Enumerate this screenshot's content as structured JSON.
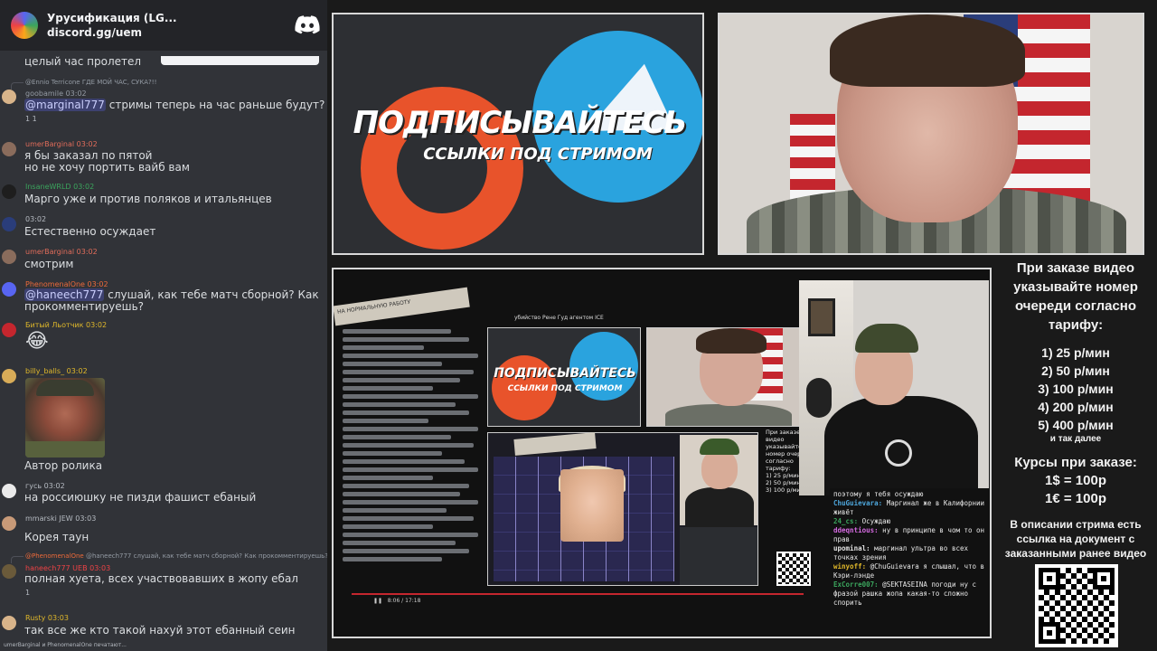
{
  "server": {
    "name": "Урусификация (LG...",
    "invite": "discord.gg/uem"
  },
  "chat": {
    "first_text": "целый час пролетел",
    "messages": [
      {
        "reply_user": "@Ennio Terricone",
        "reply_text": "ГДЕ МОЙ ЧАС, СУКА?!!",
        "user": "goobamile",
        "time": "03:02",
        "mention": "@marginal777",
        "text": " стримы теперь на час раньше будут?",
        "reactions": "1 1"
      },
      {
        "user": "umerBarginal",
        "time": "03:02",
        "text_lines": [
          "я бы заказал по пятой",
          "но не хочу портить вайб вам"
        ]
      },
      {
        "user": "InsaneWRLD",
        "time": "03:02",
        "text": "Марго уже и против поляков и итальянцев"
      },
      {
        "user": "",
        "time": "03:02",
        "text": "Естественно осуждает"
      },
      {
        "user": "umerBarginal",
        "time": "03:02",
        "text": "смотрим"
      },
      {
        "user": "PhenomenalOne",
        "time": "03:02",
        "mention": "@haneech777",
        "text": " слушай, как тебе матч сборной? Как прокомментируешь?"
      },
      {
        "user": "Битый Льотчик",
        "time": "03:02",
        "emoji": "😂"
      },
      {
        "user": "billy_balls_",
        "time": "03:02",
        "text": "Автор ролика"
      },
      {
        "user": "гусь",
        "time": "03:02",
        "text": "на россиюшку не пизди фашист ебаный"
      },
      {
        "user": "mmarski",
        "badge": "JEW",
        "time": "03:03",
        "text": "Корея таун"
      },
      {
        "reply_user": "@PhenomenalOne",
        "reply_text": "@haneech777 слушай, как тебе матч сборной? Как прокомментируешь?",
        "user": "haneech777",
        "badge": "UEB",
        "time": "03:03",
        "text": "полная хуета, всех участвовавших в жопу ебал",
        "reactions": "1"
      },
      {
        "user": "Rusty",
        "time": "03:03",
        "text": "так все же кто такой нахуй этот ебанный сеин"
      }
    ],
    "typing": "umerBarginal и PhenomenalOne печатают..."
  },
  "promo": {
    "title": "ПОДПИСЫВАЙТЕСЬ",
    "subtitle": "ССЫЛКИ ПОД СТРИМОМ"
  },
  "screen": {
    "tape_text": "НА НОРМАЛЬНУЮ РАБОТУ",
    "header_text": "убийство Рене Гуд агентом ICE",
    "video_time": "8:06 / 17:18"
  },
  "overlay_chat": [
    {
      "nick": "",
      "text": "поэтому я тебя осуждаю"
    },
    {
      "nick": "ChuGuievara:",
      "text": " Маргинал же в Калифорнии живёт"
    },
    {
      "nick": "24_cs:",
      "text": " Осуждаю"
    },
    {
      "nick": "ddeqntious:",
      "text": " ну в принципе в чом то он прав"
    },
    {
      "nick": "upominal:",
      "text": " маргинал ультра во всех точках зрения"
    },
    {
      "nick": "winyoff:",
      "text": " @ChuGuievara я слышал, что в Кэри-лэнде"
    },
    {
      "nick": "ExCorre007:",
      "text": " @SEKTASEINA погоди ну с фразой рашка жопа какая-то сложно спорить"
    }
  ],
  "side": {
    "intro": "При заказе видео указывайте номер очереди согласно тарифу:",
    "tariffs": [
      "1) 25 р/мин",
      "2) 50 р/мин",
      "3) 100 р/мин",
      "4) 200 р/мин",
      "5) 400 р/мин"
    ],
    "etc": "и так далее",
    "courses_title": "Курсы при заказе:",
    "course_usd": "1$ = 100р",
    "course_eur": "1€ = 100р",
    "doc_note": "В описании стрима есть ссылка на документ с заказанными ранее видео"
  },
  "colors": {
    "discord_bg": "#313338",
    "header_bg": "#232428",
    "promo_orange": "#e8532b",
    "telegram_blue": "#2aa3de"
  }
}
